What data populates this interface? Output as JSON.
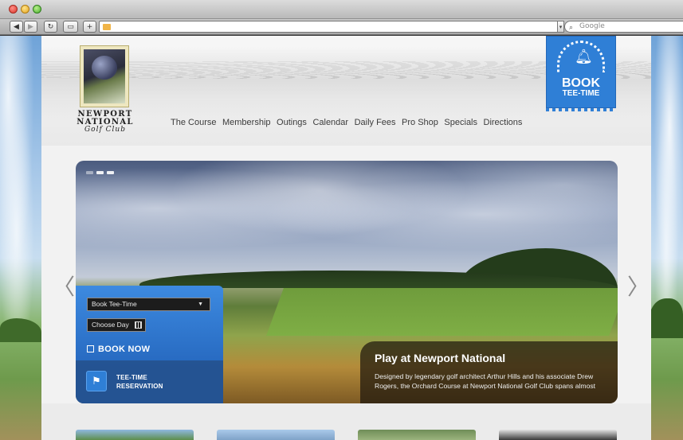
{
  "browser": {
    "search_placeholder": "Google"
  },
  "site": {
    "logo": {
      "name_line1": "NEWPORT",
      "name_line2": "NATIONAL",
      "name_line3": "Golf Club"
    },
    "nav": {
      "items": [
        "The Course",
        "Membership",
        "Outings",
        "Calendar",
        "Daily Fees",
        "Pro Shop",
        "Specials",
        "Directions"
      ]
    },
    "book_badge": {
      "line1": "BOOK",
      "line2": "TEE-TIME"
    },
    "booking": {
      "select_value": "Book Tee-Time",
      "day_value": "Choose Day",
      "book_now": "BOOK NOW",
      "reservation_line1": "TEE-TIME",
      "reservation_line2": "RESERVATION"
    },
    "hero": {
      "title": "Play at Newport National",
      "body_line1": "Designed by legendary golf architect Arthur Hills and his associate Drew",
      "body_line2": "Rogers, the Orchard Course at Newport National Golf Club spans almost"
    }
  },
  "colors": {
    "brand_blue": "#2f7fd6"
  }
}
